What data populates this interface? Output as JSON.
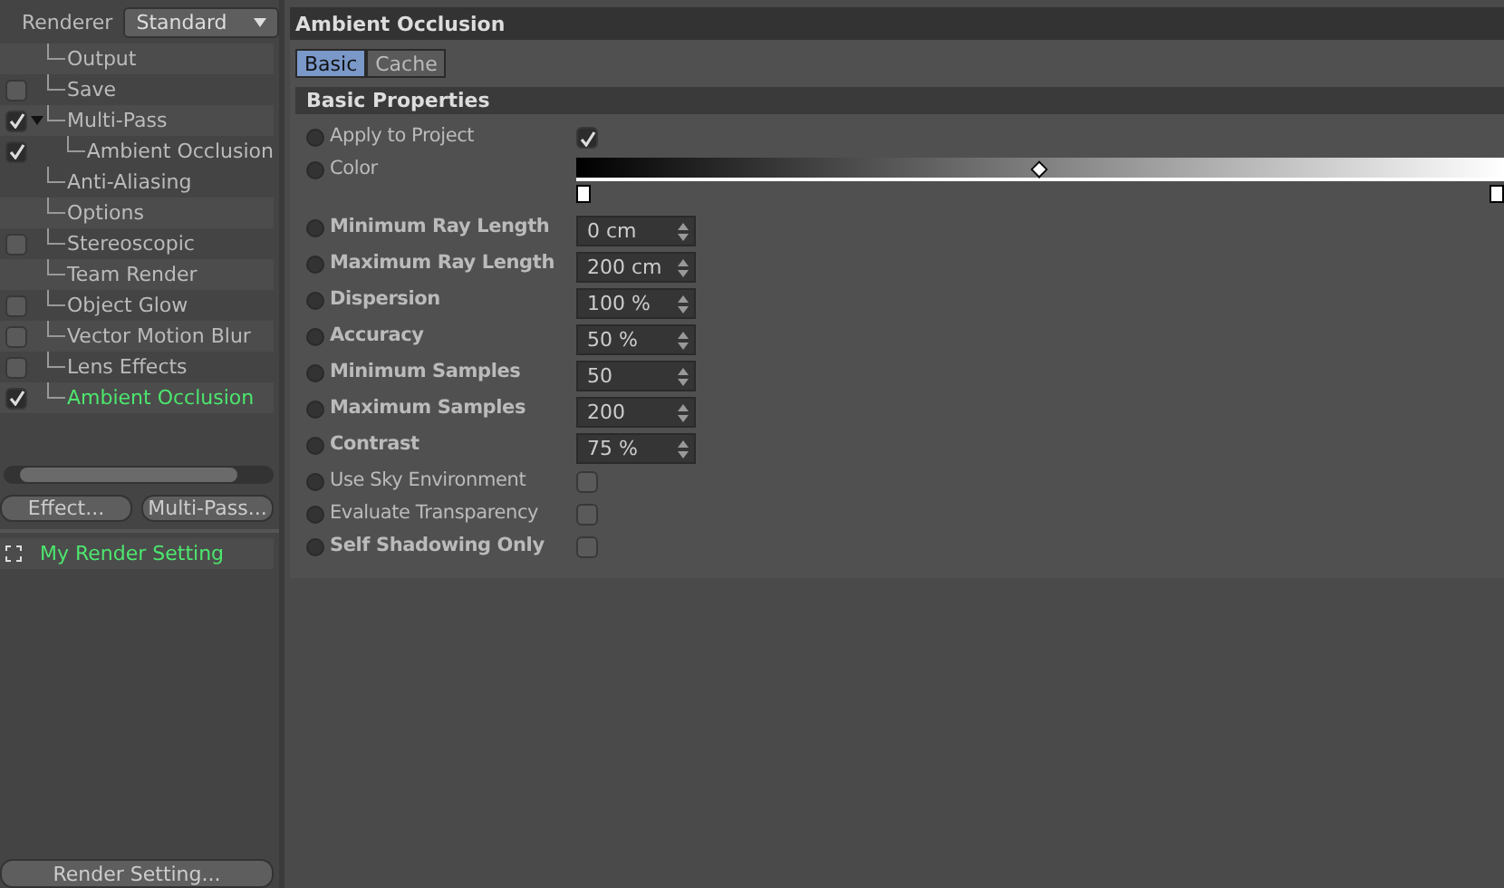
{
  "renderer": {
    "label": "Renderer",
    "value": "Standard"
  },
  "tree": [
    {
      "label": "Output",
      "kind": "plain"
    },
    {
      "label": "Save",
      "kind": "checkbox",
      "checked": false,
      "selected": false
    },
    {
      "label": "Multi-Pass",
      "kind": "checkbox",
      "checked": true,
      "selected": false,
      "expanded": true,
      "children": [
        {
          "label": "Ambient Occlusion",
          "kind": "checkbox",
          "checked": true,
          "selected": false
        }
      ]
    },
    {
      "label": "Anti-Aliasing",
      "kind": "plain"
    },
    {
      "label": "Options",
      "kind": "plain"
    },
    {
      "label": "Stereoscopic",
      "kind": "checkbox",
      "checked": false,
      "selected": false
    },
    {
      "label": "Team Render",
      "kind": "plain"
    },
    {
      "label": "Object Glow",
      "kind": "checkbox",
      "checked": false,
      "selected": false
    },
    {
      "label": "Vector Motion Blur",
      "kind": "checkbox",
      "checked": false,
      "selected": false
    },
    {
      "label": "Lens Effects",
      "kind": "checkbox",
      "checked": false,
      "selected": false
    },
    {
      "label": "Ambient Occlusion",
      "kind": "checkbox",
      "checked": true,
      "selected": true
    }
  ],
  "buttons": [
    "Effect...",
    "Multi-Pass..."
  ],
  "settings": [
    {
      "label": "My Render Setting",
      "selected": true
    }
  ],
  "bottom_button": "Render Setting...",
  "panel": {
    "title": "Ambient Occlusion",
    "tabs": [
      {
        "label": "Basic",
        "selected": true
      },
      {
        "label": "Cache",
        "selected": false
      }
    ],
    "section": "Basic Properties",
    "properties": [
      {
        "kind": "checkbox",
        "label": "Apply to Project",
        "bold": false,
        "checked": true
      },
      {
        "kind": "gradient",
        "label": "Color",
        "bold": false
      },
      {
        "kind": "number",
        "label": "Minimum Ray Length",
        "bold": true,
        "value": "0 cm"
      },
      {
        "kind": "number",
        "label": "Maximum Ray Length",
        "bold": true,
        "value": "200 cm"
      },
      {
        "kind": "number",
        "label": "Dispersion",
        "bold": true,
        "value": "100 %"
      },
      {
        "kind": "number",
        "label": "Accuracy",
        "bold": true,
        "value": "50 %"
      },
      {
        "kind": "number",
        "label": "Minimum Samples",
        "bold": true,
        "value": "50"
      },
      {
        "kind": "number",
        "label": "Maximum Samples",
        "bold": true,
        "value": "200"
      },
      {
        "kind": "number",
        "label": "Contrast",
        "bold": true,
        "value": "75 %"
      },
      {
        "kind": "checkbox",
        "label": "Use Sky Environment",
        "bold": false,
        "checked": false
      },
      {
        "kind": "checkbox",
        "label": "Evaluate Transparency",
        "bold": false,
        "checked": false
      },
      {
        "kind": "checkbox",
        "label": "Self Shadowing Only",
        "bold": true,
        "checked": false
      }
    ]
  }
}
